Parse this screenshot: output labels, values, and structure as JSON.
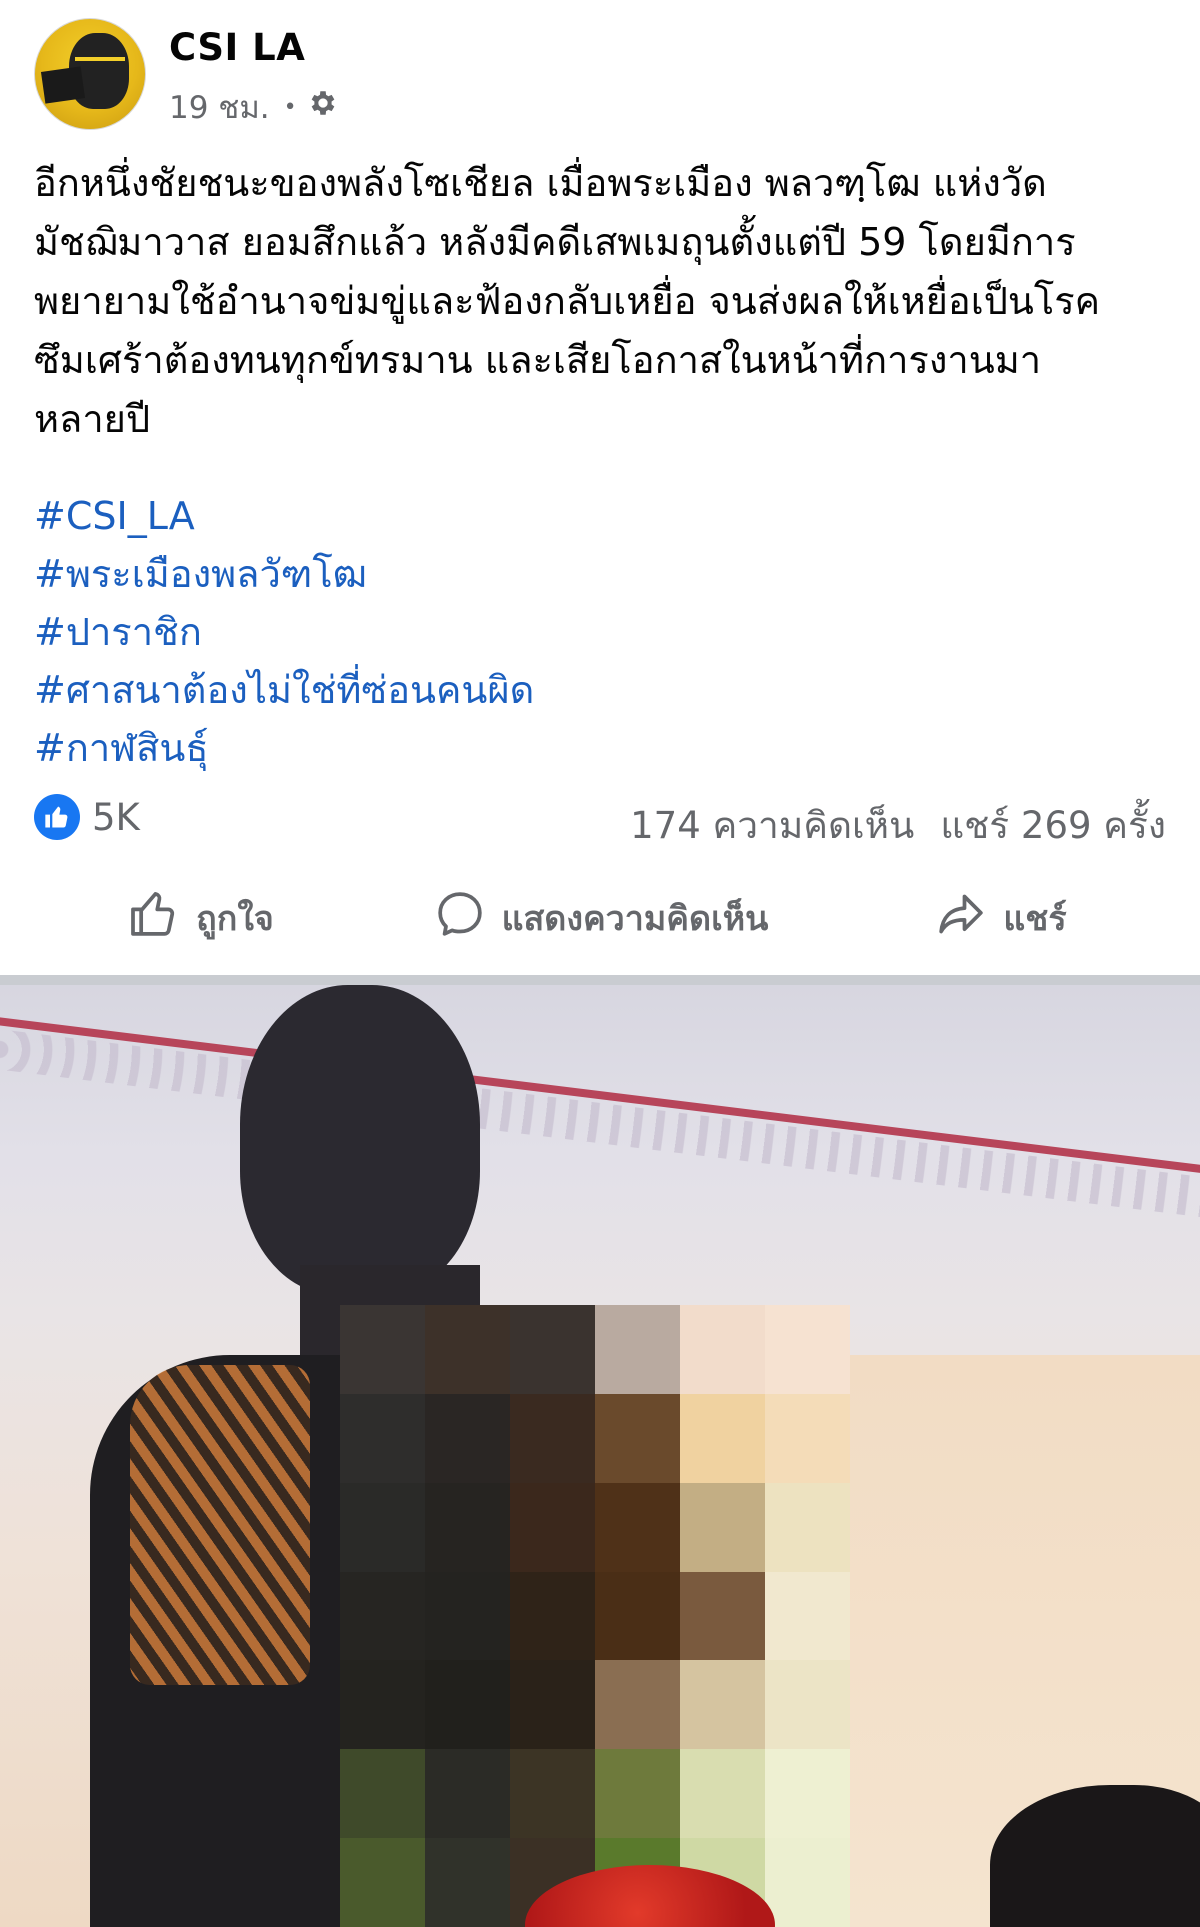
{
  "post": {
    "page_name": "CSI LA",
    "time": "19 ชม.",
    "separator": "•",
    "body": "อีกหนึ่งชัยชนะของพลังโซเชียล เมื่อพระเมือง พลวฑฺโฒ แห่งวัด\nมัชฌิมาวาส ยอมสึกแล้ว หลังมีคดีเสพเมถุนตั้งแต่ปี 59 โดยมีการ\nพยายามใช้อำนาจข่มขู่และฟ้องกลับเหยื่อ จนส่งผลให้เหยื่อเป็นโรค\nซึมเศร้าต้องทนทุกข์ทรมาน และเสียโอกาสในหน้าที่การงานมา\nหลายปี",
    "hashtags": [
      "#CSI_LA",
      "#พระเมืองพลวัฑโฒ",
      "#ปาราชิก",
      "#ศาสนาต้องไม่ใช่ที่ซ่อนคนผิด",
      "#กาฬสินธุ์"
    ]
  },
  "stats": {
    "likes": "5K",
    "comments": "174 ความคิดเห็น",
    "shares": "แชร์ 269 ครั้ง"
  },
  "actions": {
    "like": "ถูกใจ",
    "comment": "แสดงความคิดเห็น",
    "share": "แชร์"
  },
  "icons": {
    "privacy": "gear-icon",
    "like_reaction": "thumbs-up-icon",
    "like_action": "thumbs-up-outline-icon",
    "comment_action": "speech-bubble-icon",
    "share_action": "share-arrow-icon"
  },
  "colors": {
    "link": "#1b5fbf",
    "secondary_text": "#65676b",
    "like_blue": "#1877f2",
    "divider": "#c9ccd1"
  },
  "photo": {
    "mosaic_colors": [
      "#3a3533",
      "#3d3129",
      "#3a332f",
      "#b9aaa0",
      "#f2dccb",
      "#f6e2d1",
      "#2e2d2c",
      "#2a2624",
      "#3a2a20",
      "#6a4a2c",
      "#f0d2a0",
      "#f4dcb8",
      "#2a2a28",
      "#262421",
      "#3b281c",
      "#4f3118",
      "#c3ae84",
      "#ede2c0",
      "#262522",
      "#242320",
      "#2f2318",
      "#4a2e16",
      "#7a5a3e",
      "#f1e8cf",
      "#24231f",
      "#21201c",
      "#2a2219",
      "#8a6e52",
      "#d5c4a0",
      "#ece4c6",
      "#3f4a2a",
      "#2b2b26",
      "#3c3425",
      "#6e7a3c",
      "#d9ddb0",
      "#eef0d2",
      "#4a5a2c",
      "#30322a",
      "#3b3025",
      "#5a7a2c",
      "#cfd9a4",
      "#ecefd0"
    ]
  }
}
